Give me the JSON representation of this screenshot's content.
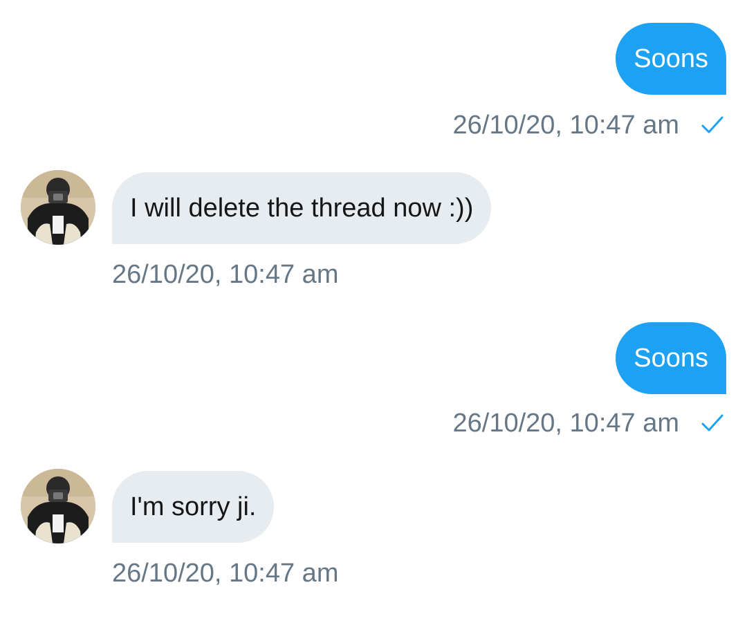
{
  "messages": [
    {
      "direction": "outgoing",
      "text": "Soons",
      "timestamp": "26/10/20, 10:47 am",
      "status_icon": "check-icon"
    },
    {
      "direction": "incoming",
      "text": "I will delete the thread now :))",
      "timestamp": "26/10/20, 10:47 am",
      "avatar_icon": "avatar"
    },
    {
      "direction": "outgoing",
      "text": "Soons",
      "timestamp": "26/10/20, 10:47 am",
      "status_icon": "check-icon"
    },
    {
      "direction": "incoming",
      "text": "I'm sorry ji.",
      "timestamp": "26/10/20, 10:47 am",
      "avatar_icon": "avatar"
    }
  ],
  "colors": {
    "outgoing_bubble": "#1da1f2",
    "incoming_bubble": "#e6ecf0",
    "timestamp": "#657786",
    "check": "#1da1f2"
  }
}
